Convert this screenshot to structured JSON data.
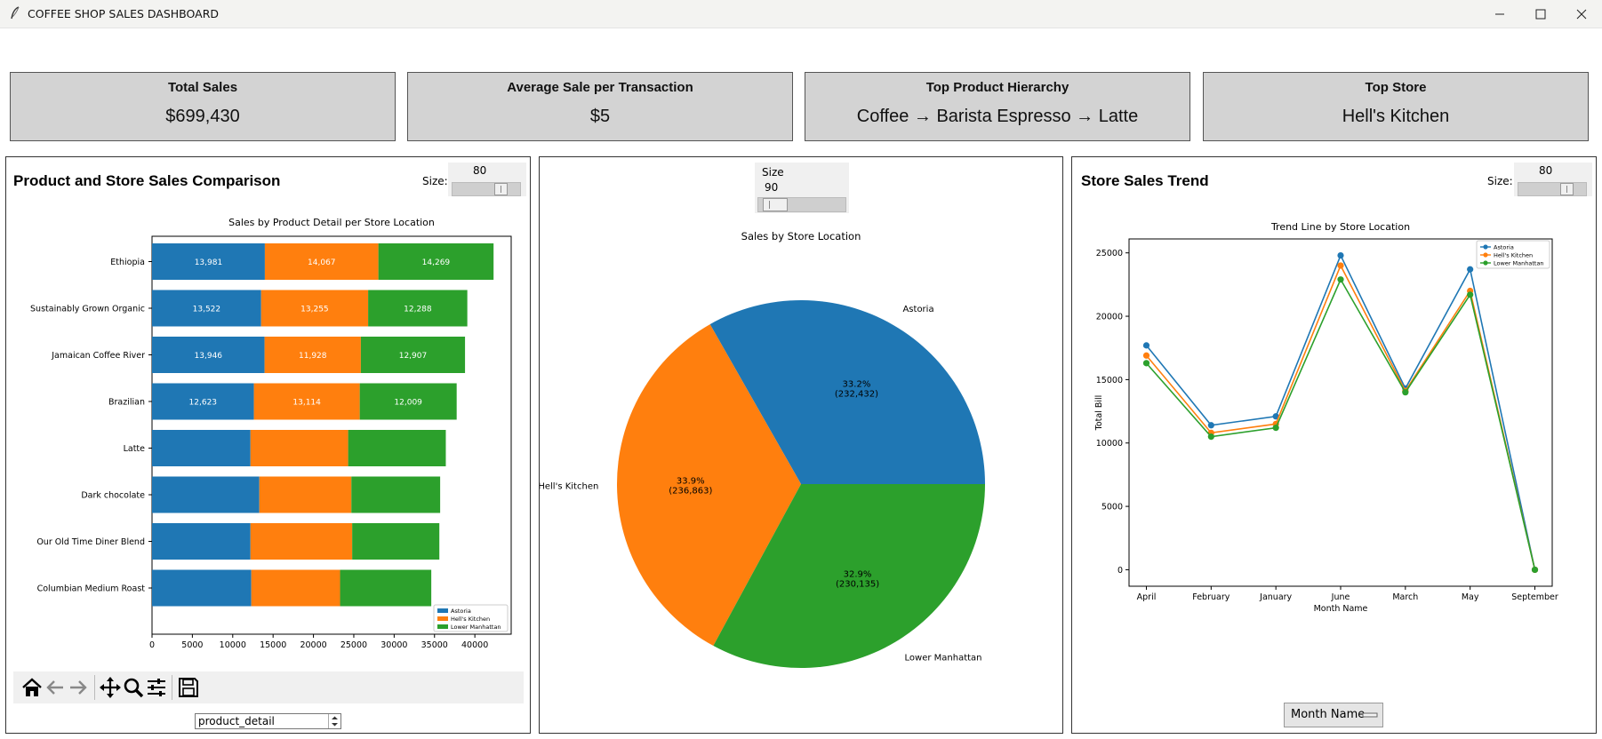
{
  "window": {
    "title": "COFFEE SHOP SALES DASHBOARD",
    "controls": [
      "minimize",
      "maximize",
      "close"
    ]
  },
  "kpis": [
    {
      "title": "Total Sales",
      "value": "$699,430"
    },
    {
      "title": "Average Sale per Transaction",
      "value": "$5"
    },
    {
      "title": "Top Product Hierarchy",
      "value": "Coffee → Barista Espresso → Latte"
    },
    {
      "title": "Top Store",
      "value": "Hell's Kitchen"
    }
  ],
  "left_panel": {
    "title": "Product and Store Sales Comparison",
    "size_label": "Size:",
    "size_value": "80",
    "size_level": 0.8,
    "toolbar_icons": [
      "home-icon",
      "back-arrow-icon",
      "forward-arrow-icon",
      "pan-icon",
      "zoom-icon",
      "configure-icon",
      "save-icon"
    ],
    "dropdown_value": "product_detail"
  },
  "middle_panel": {
    "size_label": "Size",
    "size_value": "90",
    "size_level": 0.9
  },
  "right_panel": {
    "title": "Store Sales Trend",
    "size_label": "Size:",
    "size_value": "80",
    "size_level": 0.8,
    "dropdown_value": "Month Name"
  },
  "colors": {
    "astoria": "#1f77b4",
    "hells_kitchen": "#ff7f0e",
    "lower_manhattan": "#2ca02c"
  },
  "chart_data": [
    {
      "type": "bar",
      "orientation": "horizontal",
      "stacked": true,
      "title": "Sales by Product Detail per Store Location",
      "xlabel": "",
      "ylabel": "",
      "categories": [
        "Ethiopia",
        "Sustainably Grown Organic",
        "Jamaican Coffee River",
        "Brazilian",
        "Latte",
        "Dark chocolate",
        "Our Old Time Diner Blend",
        "Columbian Medium Roast"
      ],
      "series": [
        {
          "name": "Astoria",
          "values": [
            13981,
            13522,
            13946,
            12623,
            12200,
            13300,
            12200,
            12300
          ],
          "labels": [
            "13,981",
            "13,522",
            "13,946",
            "12,623",
            "",
            "",
            "",
            ""
          ]
        },
        {
          "name": "Hell's Kitchen",
          "values": [
            14067,
            13255,
            11928,
            13114,
            12100,
            11400,
            12600,
            11000
          ],
          "labels": [
            "14,067",
            "13,255",
            "11,928",
            "13,114",
            "",
            "",
            "",
            ""
          ]
        },
        {
          "name": "Lower Manhattan",
          "values": [
            14269,
            12288,
            12907,
            12009,
            12100,
            11000,
            10800,
            11300
          ],
          "labels": [
            "14,269",
            "12,288",
            "12,907",
            "12,009",
            "",
            "",
            "",
            ""
          ]
        }
      ],
      "xlim": [
        0,
        44500
      ],
      "xticks": [
        "0",
        "5000",
        "10000",
        "15000",
        "20000",
        "25000",
        "30000",
        "35000",
        "40000"
      ],
      "legend": [
        "Astoria",
        "Hell's Kitchen",
        "Lower Manhattan"
      ],
      "legend_position": "lower-right"
    },
    {
      "type": "pie",
      "title": "Sales by Store Location",
      "slices": [
        {
          "name": "Astoria",
          "value": 232432,
          "pct": "33.2%",
          "value_label": "(232,432)"
        },
        {
          "name": "Hell's Kitchen",
          "value": 236863,
          "pct": "33.9%",
          "value_label": "(236,863)"
        },
        {
          "name": "Lower Manhattan",
          "value": 230135,
          "pct": "32.9%",
          "value_label": "(230,135)"
        }
      ]
    },
    {
      "type": "line",
      "title": "Trend Line by Store Location",
      "xlabel": "Month Name",
      "ylabel": "Total Bill",
      "x": [
        "April",
        "February",
        "January",
        "June",
        "March",
        "May",
        "September"
      ],
      "series": [
        {
          "name": "Astoria",
          "values": [
            17700,
            11400,
            12100,
            24800,
            14300,
            23700,
            0
          ]
        },
        {
          "name": "Hell's Kitchen",
          "values": [
            16900,
            10800,
            11500,
            24000,
            14100,
            22000,
            0
          ]
        },
        {
          "name": "Lower Manhattan",
          "values": [
            16300,
            10500,
            11200,
            22900,
            14000,
            21700,
            0
          ]
        }
      ],
      "ylim": [
        -1300,
        26100
      ],
      "yticks": [
        "0",
        "5000",
        "10000",
        "15000",
        "20000",
        "25000"
      ],
      "legend": [
        "Astoria",
        "Hell's Kitchen",
        "Lower Manhattan"
      ],
      "legend_position": "top-right"
    }
  ]
}
